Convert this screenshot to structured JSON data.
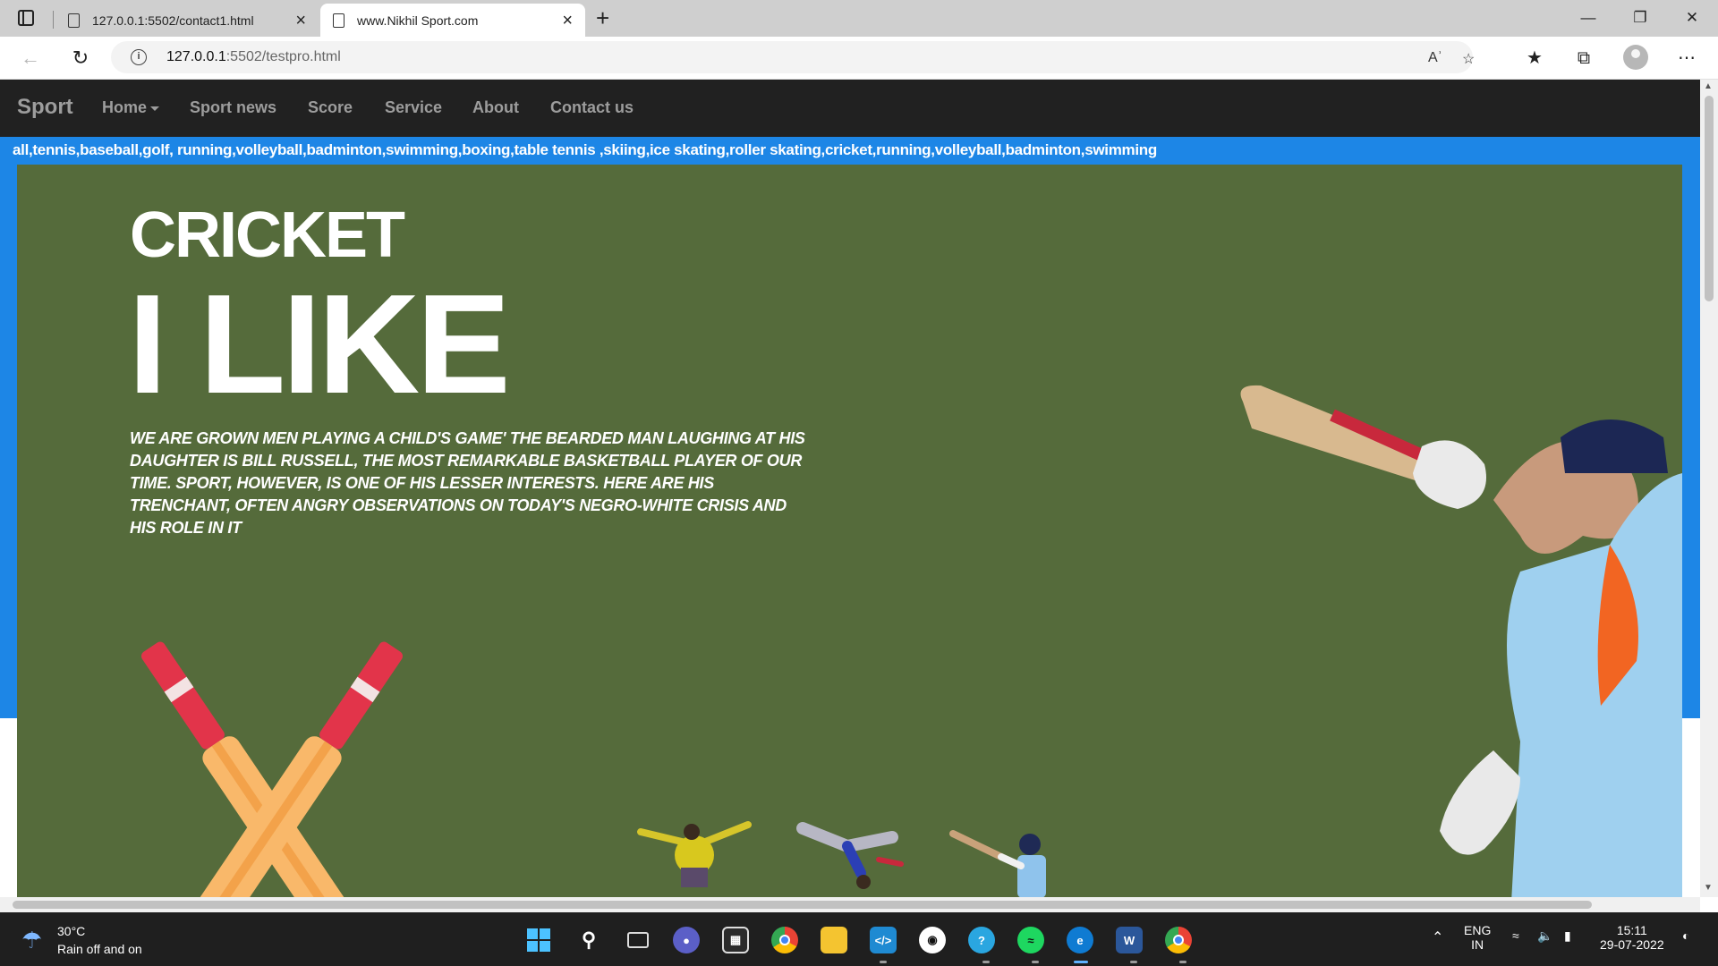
{
  "browser": {
    "tabs": [
      {
        "title": "127.0.0.1:5502/contact1.html",
        "active": false
      },
      {
        "title": "www.Nikhil Sport.com",
        "active": true
      }
    ],
    "url_host": "127.0.0.1",
    "url_rest": ":5502/testpro.html"
  },
  "site": {
    "brand": "Sport",
    "nav": [
      "Home",
      "Sport news",
      "Score",
      "Service",
      "About",
      "Contact us"
    ],
    "marquee": "all,tennis,baseball,golf,  running,volleyball,badminton,swimming,boxing,table tennis ,skiing,ice skating,roller skating,cricket,running,volleyball,badminton,swimming",
    "hero": {
      "heading_small": "CRICKET",
      "heading_large": "I LIKE",
      "quote": "WE ARE GROWN MEN PLAYING A CHILD'S GAME' THE BEARDED MAN LAUGHING AT HIS DAUGHTER IS BILL RUSSELL, THE MOST REMARKABLE BASKETBALL PLAYER OF OUR TIME. SPORT, HOWEVER, IS ONE OF HIS LESSER INTERESTS. HERE ARE HIS TRENCHANT, OFTEN ANGRY OBSERVATIONS ON TODAY'S NEGRO-WHITE CRISIS AND HIS ROLE IN IT"
    },
    "colors": {
      "navbar": "#212121",
      "band": "#1d86e6",
      "hero": "#556b3b",
      "bat": "#f9b86a",
      "grip": "#e2344a"
    }
  },
  "taskbar": {
    "weather_temp": "30°C",
    "weather_desc": "Rain off and on",
    "lang_top": "ENG",
    "lang_bottom": "IN",
    "time": "15:11",
    "date": "29-07-2022",
    "apps": [
      "start-icon",
      "search-icon",
      "task-view-icon",
      "teams-chat-icon",
      "store-icon",
      "chrome-icon",
      "file-explorer-icon",
      "vscode-icon",
      "github-icon",
      "help-icon",
      "spotify-icon",
      "edge-icon",
      "word-icon",
      "chrome-profile-icon"
    ]
  }
}
